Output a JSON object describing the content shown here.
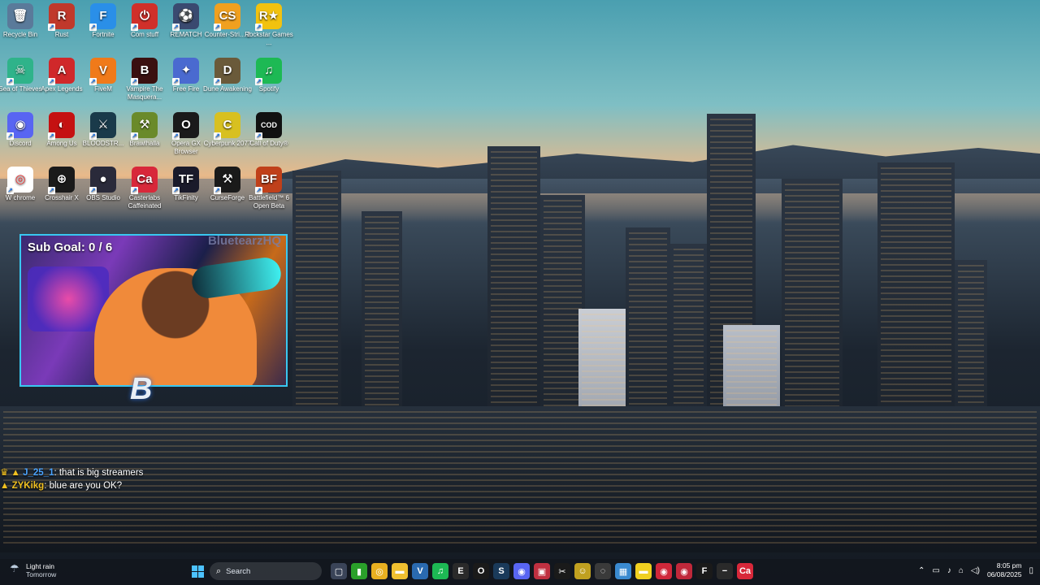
{
  "desktop": {
    "icons": [
      {
        "label": "Recycle Bin",
        "glyph": "🗑",
        "color": "#5a7a9a",
        "link": false
      },
      {
        "label": "Rust",
        "glyph": "R",
        "color": "#c0392b",
        "link": true,
        "overlay": "est Train\nvel 1 (3"
      },
      {
        "label": "Fortnite",
        "glyph": "F",
        "color": "#2a8fe8",
        "link": true
      },
      {
        "label": "Com stuff",
        "glyph": "⏻",
        "color": "#d0302a",
        "link": true
      },
      {
        "label": "REMATCH",
        "glyph": "⚽",
        "color": "#3a4a70",
        "link": true
      },
      {
        "label": "Counter-Stri... 2",
        "glyph": "CS",
        "color": "#f0a020",
        "link": true
      },
      {
        "label": "Rockstar Games ...",
        "glyph": "R★",
        "color": "#f2c20f",
        "link": true
      },
      {
        "label": "Sea of Thieves",
        "glyph": "☠",
        "color": "#2fb38a",
        "link": true
      },
      {
        "label": "Apex Legends",
        "glyph": "A",
        "color": "#d0282a",
        "link": true
      },
      {
        "label": "FiveM",
        "glyph": "V",
        "color": "#f07a1a",
        "link": true
      },
      {
        "label": "Vampire The Masquera...",
        "glyph": "B",
        "color": "#3a1010",
        "link": true
      },
      {
        "label": "Free Fire",
        "glyph": "✦",
        "color": "#4a6ad0",
        "link": true
      },
      {
        "label": "Dune Awakening",
        "glyph": "D",
        "color": "#6a5a3a",
        "link": true
      },
      {
        "label": "Spotify",
        "glyph": "♫",
        "color": "#1db954",
        "link": true
      },
      {
        "label": "Discord",
        "glyph": "◉",
        "color": "#5865f2",
        "link": true
      },
      {
        "label": "Among Us",
        "glyph": "◐",
        "color": "#c51111",
        "link": true
      },
      {
        "label": "BLOODSTR...",
        "glyph": "⚔",
        "color": "#1a3a4a",
        "link": true
      },
      {
        "label": "Brawlhalla",
        "glyph": "⚒",
        "color": "#6a8a2a",
        "link": true
      },
      {
        "label": "Opera GX Browser",
        "glyph": "O",
        "color": "#1a1a1a",
        "link": true
      },
      {
        "label": "Cyberpunk 2077",
        "glyph": "C",
        "color": "#d8c020",
        "link": true
      },
      {
        "label": "Call of Duty®",
        "glyph": "COD",
        "color": "#111111",
        "link": true
      },
      {
        "label": "W chrome",
        "glyph": "◎",
        "color": "#ffffff",
        "link": true
      },
      {
        "label": "Crosshair X",
        "glyph": "⊕",
        "color": "#1a1a1a",
        "link": true
      },
      {
        "label": "OBS Studio",
        "glyph": "●",
        "color": "#2a2a3a",
        "link": true
      },
      {
        "label": "Casterlabs Caffeinated",
        "glyph": "Ca",
        "color": "#d8283a",
        "link": true
      },
      {
        "label": "TikFinity",
        "glyph": "TF",
        "color": "#1a1a2a",
        "link": true
      },
      {
        "label": "CurseForge",
        "glyph": "⚒",
        "color": "#1a1a1a",
        "link": true
      },
      {
        "label": "Battlefield™ 6 Open Beta",
        "glyph": "BF",
        "color": "#c0401a",
        "link": true
      }
    ]
  },
  "stream_overlay": {
    "sub_goal": "Sub Goal: 0 / 6",
    "channel_name": "BluetearzHQ",
    "logo_text": "B"
  },
  "chat": [
    {
      "badges": "♛ ▲ ",
      "user": "J_25_1",
      "message": ": that is big streamers"
    },
    {
      "badges": "▲ ",
      "user": "ZYKikg",
      "message": ": blue are you OK?"
    }
  ],
  "taskbar": {
    "weather_title": "Light rain",
    "weather_sub": "Tomorrow",
    "search_placeholder": "Search",
    "apps": [
      {
        "name": "task-view",
        "glyph": "▢",
        "color": "#3a4458"
      },
      {
        "name": "xbox",
        "glyph": "▮",
        "color": "#2aa02a"
      },
      {
        "name": "chrome",
        "glyph": "◎",
        "color": "#e8b020"
      },
      {
        "name": "file-explorer",
        "glyph": "▬",
        "color": "#f0c030"
      },
      {
        "name": "vscode",
        "glyph": "V",
        "color": "#2a6ab0"
      },
      {
        "name": "spotify",
        "glyph": "♫",
        "color": "#1db954"
      },
      {
        "name": "epic",
        "glyph": "E",
        "color": "#2a2a2a"
      },
      {
        "name": "opera",
        "glyph": "O",
        "color": "#1a1a1a"
      },
      {
        "name": "steam",
        "glyph": "S",
        "color": "#1a3a5a"
      },
      {
        "name": "discord",
        "glyph": "◉",
        "color": "#5865f2"
      },
      {
        "name": "app-red",
        "glyph": "▣",
        "color": "#c03040"
      },
      {
        "name": "capcut",
        "glyph": "✂",
        "color": "#1a1a1a"
      },
      {
        "name": "app-yellow",
        "glyph": "☺",
        "color": "#c0a020"
      },
      {
        "name": "app-spin",
        "glyph": "◌",
        "color": "#3a3a3a"
      },
      {
        "name": "weather-app",
        "glyph": "▦",
        "color": "#3a8ad0"
      },
      {
        "name": "sticky-notes",
        "glyph": "▬",
        "color": "#f0d020"
      },
      {
        "name": "app-record",
        "glyph": "◉",
        "color": "#d0283a"
      },
      {
        "name": "app-red2",
        "glyph": "◉",
        "color": "#c0283a"
      },
      {
        "name": "faceit",
        "glyph": "F",
        "color": "#1a1a1a"
      },
      {
        "name": "app-dash",
        "glyph": "−",
        "color": "#2a2a2a"
      },
      {
        "name": "casterlabs",
        "glyph": "Ca",
        "color": "#d8283a"
      }
    ],
    "time": "8:05 pm",
    "date": "06/08/2025"
  }
}
